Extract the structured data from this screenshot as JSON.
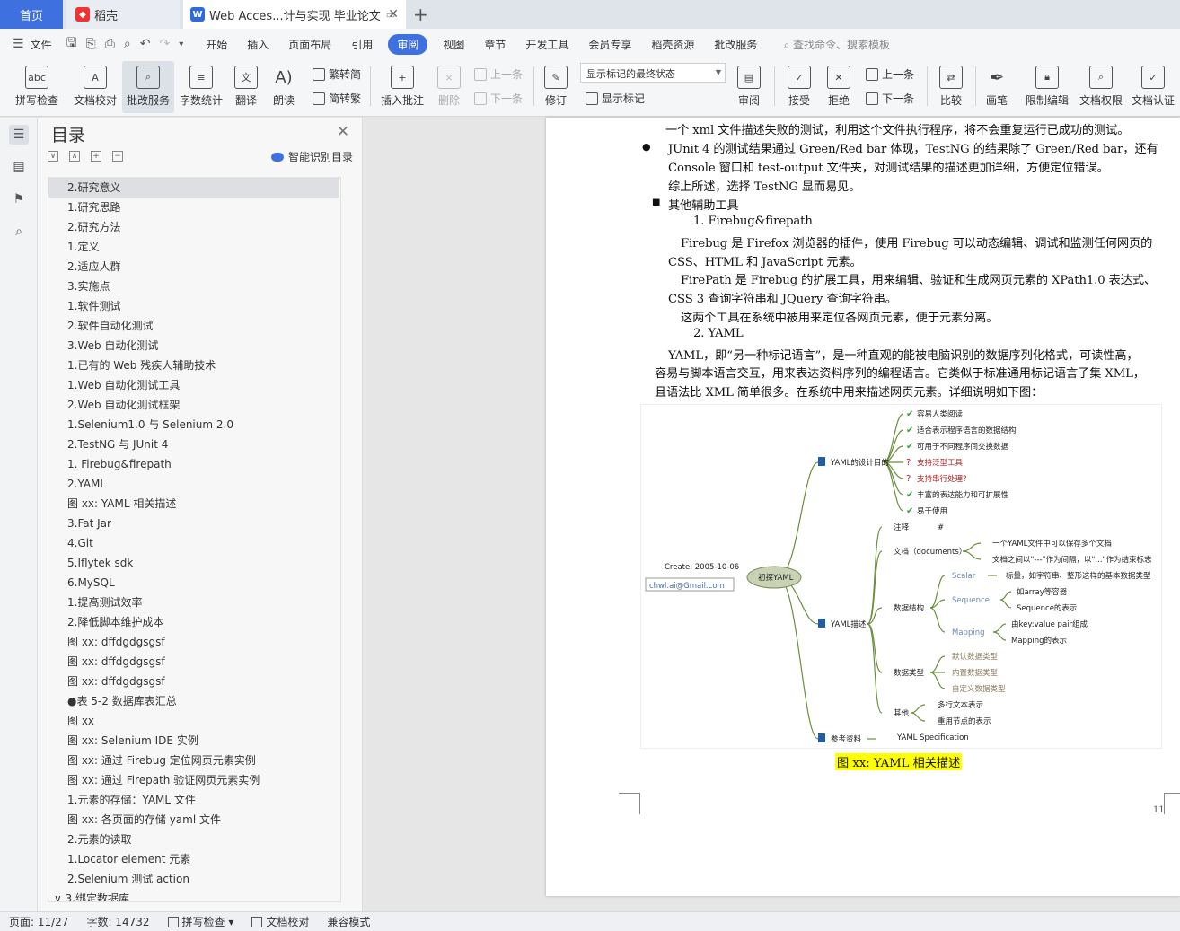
{
  "tabs": {
    "home": "首页",
    "daoke": "稻壳",
    "document": "Web Acces...计与实现 毕业论文"
  },
  "menubar": {
    "file": "文件",
    "items": [
      "开始",
      "插入",
      "页面布局",
      "引用",
      "审阅",
      "视图",
      "章节",
      "开发工具",
      "会员专享",
      "稻壳资源",
      "批改服务"
    ],
    "active": "审阅",
    "search_placeholder": "查找命令、搜索模板"
  },
  "toolbar": {
    "spell_check": "拼写检查",
    "doc_proof": "文档校对",
    "review_service": "批改服务",
    "word_count": "字数统计",
    "translate": "翻译",
    "read_aloud": "朗读",
    "to_traditional": "繁转简",
    "to_simplified": "简转繁",
    "insert_comment": "插入批注",
    "delete": "删除",
    "prev": "上一条",
    "next": "下一条",
    "track_changes": "修订",
    "markup_state": "显示标记的最终状态",
    "show_markup": "显示标记",
    "review_pane": "审阅",
    "accept": "接受",
    "reject": "拒绝",
    "prev2": "上一条",
    "next2": "下一条",
    "compare": "比较",
    "pen": "画笔",
    "restrict_edit": "限制编辑",
    "doc_permission": "文档权限",
    "doc_cert": "文档认证"
  },
  "outline": {
    "title": "目录",
    "smart_toc": "智能识别目录",
    "items": [
      "2.研究意义",
      "1.研究思路",
      "2.研究方法",
      "1.定义",
      "2.适应人群",
      "3.实施点",
      "1.软件测试",
      "2.软件自动化测试",
      "3.Web 自动化测试",
      "1.已有的 Web 残疾人辅助技术",
      "1.Web 自动化测试工具",
      "2.Web 自动化测试框架",
      "1.Selenium1.0 与 Selenium 2.0",
      "2.TestNG 与 JUnit 4",
      "1.  Firebug&firepath",
      "2.YAML",
      "图 xx: YAML 相关描述",
      "3.Fat Jar",
      "4.Git",
      "5.Iflytek sdk",
      "6.MySQL",
      "1.提高测试效率",
      "2.降低脚本维护成本",
      "图 xx: dffdgdgsgsf",
      "图 xx: dffdgdgsgsf",
      "图 xx: dffdgdgsgsf",
      "●表 5-2    数据库表汇总",
      "图 xx",
      "图 xx: Selenium IDE 实例",
      "图 xx:  通过 Firebug 定位网页元素实例",
      "图 xx:  通过 Firepath 验证网页元素实例",
      "1.元素的存储：YAML 文件",
      "图 xx:  各页面的存储 yaml 文件",
      "2.元素的读取",
      "1.Locator element 元素",
      "2.Selenium 测试 action",
      "3.绑定数据库"
    ]
  },
  "document": {
    "lines": [
      "一个 xml 文件描述失败的测试，利用这个文件执行程序，将不会重复运行已成功的测试。",
      "JUnit 4 的测试结果通过 Green/Red bar 体现，TestNG 的结果除了 Green/Red bar，还有",
      "Console 窗口和 test-output 文件夹，对测试结果的描述更加详细，方便定位错误。",
      "综上所述，选择 TestNG 显而易见。",
      "其他辅助工具",
      "1.      Firebug&firepath",
      "Firebug 是 Firefox 浏览器的插件，使用 Firebug 可以动态编辑、调试和监测任何网页的",
      "CSS、HTML 和 JavaScript 元素。",
      "FirePath 是 Firebug 的扩展工具，用来编辑、验证和生成网页元素的 XPath1.0 表达式、",
      "CSS 3 查询字符串和 JQuery 查询字符串。",
      "这两个工具在系统中被用来定位各网页元素，便于元素分离。",
      "2.      YAML",
      "YAML，即“另一种标记语言”，是一种直观的能被电脑识别的数据序列化格式，可读性高，",
      "容易与脚本语言交互，用来表达资料序列的编程语言。它类似于标准通用标记语言子集 XML，",
      "且语法比 XML 简单很多。在系统中用来描述网页元素。详细说明如下图："
    ],
    "caption": "图 xx: YAML 相关描述",
    "page_number": "11"
  },
  "mindmap": {
    "root": "初探YAML",
    "create": "Create: 2005-10-06",
    "email": "chwl.ai@Gmail.com",
    "b1": "YAML的设计目的",
    "b1_items": [
      "容易人类阅读",
      "适合表示程序语言的数据结构",
      "可用于不同程序间交换数据",
      "支持泛型工具",
      "支持串行处理?",
      "丰富的表达能力和可扩展性",
      "易于使用"
    ],
    "b2": "YAML描述",
    "comment": "注释",
    "comment_sym": "#",
    "docs": "文档（documents）",
    "docs_a": "一个YAML文件中可以保存多个文档",
    "docs_b": "文档之间以\"---\"作为间隔，以\"...\"作为结束标志",
    "struct": "数据结构",
    "scalar": "Scalar",
    "scalar_d": "标量，如字符串、整形这样的基本数据类型",
    "sequence": "Sequence",
    "seq_a": "如array等容器",
    "seq_b": "Sequence的表示",
    "mapping": "Mapping",
    "map_a": "由key:value pair组成",
    "map_b": "Mapping的表示",
    "types": "数据类型",
    "types_items": [
      "默认数据类型",
      "内置数据类型",
      "自定义数据类型"
    ],
    "other": "其他",
    "other_items": [
      "多行文本表示",
      "重用节点的表示"
    ],
    "b3": "参考资料",
    "ref": "YAML Specification"
  },
  "statusbar": {
    "page": "页面: 11/27",
    "words": "字数: 14732",
    "spell": "拼写检查",
    "proof": "文档校对",
    "compat": "兼容模式"
  }
}
